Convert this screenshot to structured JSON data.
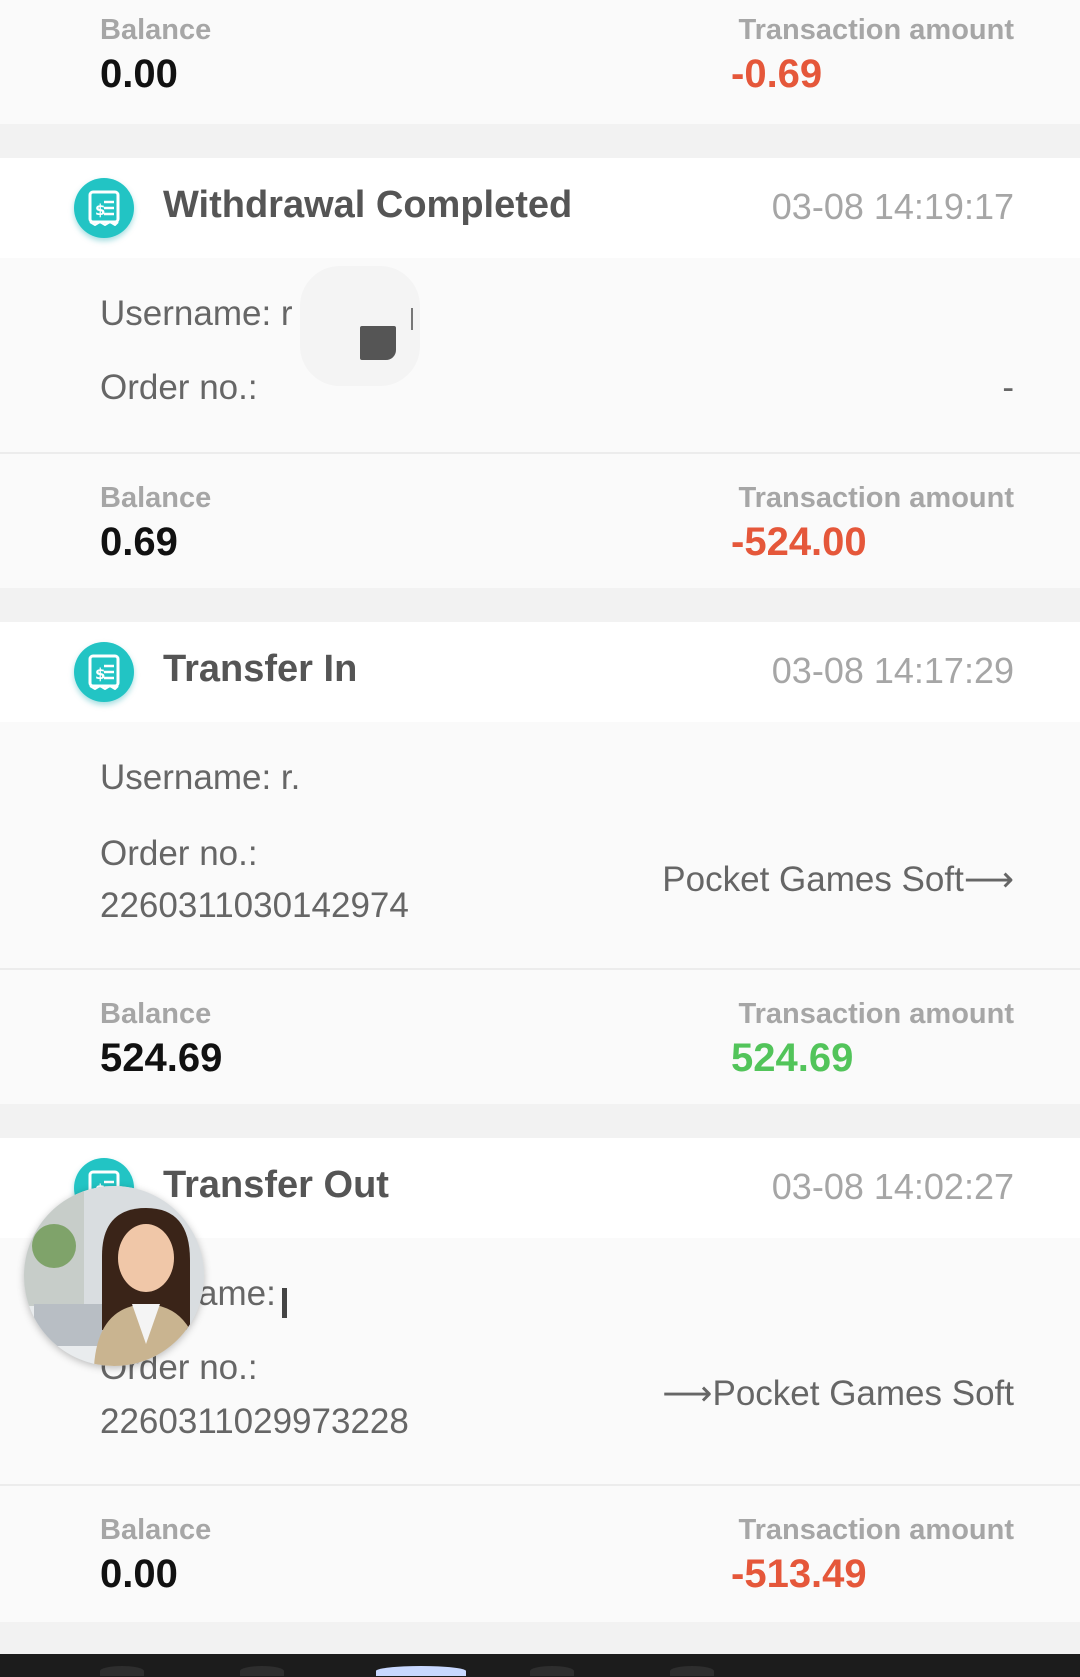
{
  "labels": {
    "balance": "Balance",
    "transaction_amount": "Transaction amount",
    "username": "Username:",
    "order_no": "Order no.:"
  },
  "colors": {
    "negative_amount": "#e5573a",
    "positive_amount": "#52c45a",
    "icon_accent": "#22c4c4"
  },
  "top_partial": {
    "balance": "0.00",
    "amount": "-0.69"
  },
  "transactions": [
    {
      "icon": "receipt-dollar-icon",
      "title": "Withdrawal Completed",
      "time": "03-08 14:19:17",
      "username_visible": "Username: r",
      "order_no": "",
      "side_value": "-",
      "balance": "0.69",
      "amount": "-524.00"
    },
    {
      "icon": "receipt-dollar-icon",
      "title": "Transfer In",
      "time": "03-08 14:17:29",
      "username_visible": "Username: r.",
      "order_no": "2260311030142974",
      "side_value": "Pocket Games Soft⟶",
      "balance": "524.69",
      "amount": "524.69"
    },
    {
      "icon": "receipt-dollar-icon",
      "title": "Transfer Out",
      "time": "03-08 14:02:27",
      "username_visible": "ame:",
      "order_no": "2260311029973228",
      "side_value": "⟶Pocket Games Soft",
      "balance": "0.00",
      "amount": "-513.49"
    }
  ]
}
